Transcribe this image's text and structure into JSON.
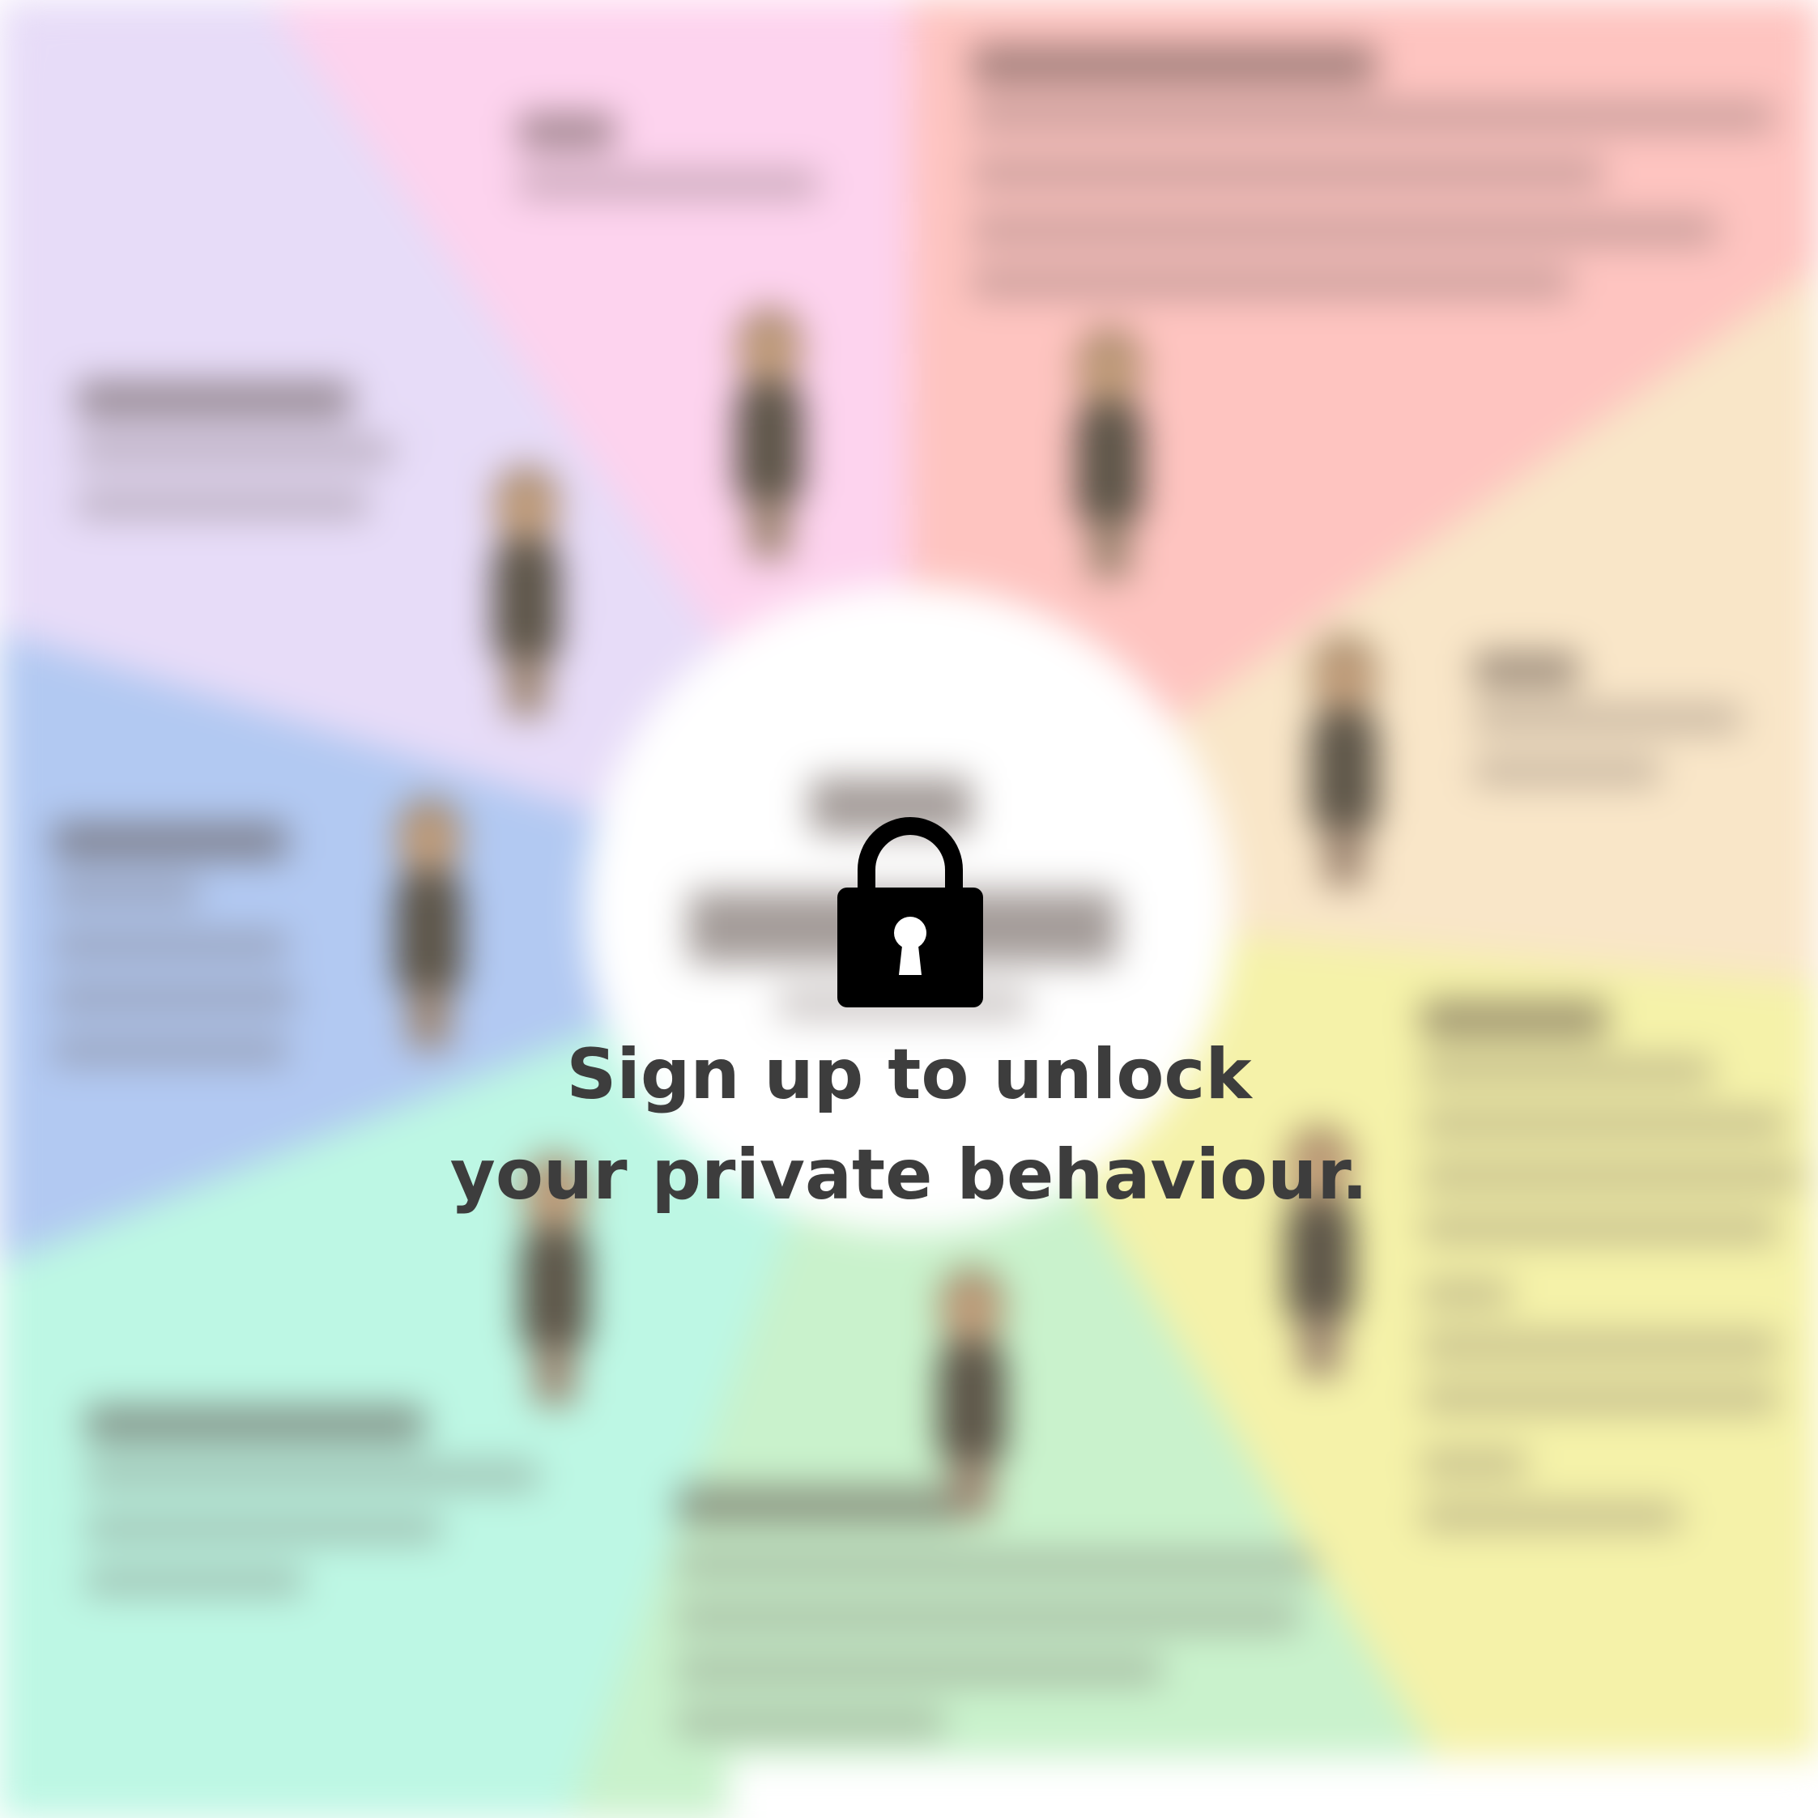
{
  "overlay": {
    "lock_icon": "padlock-icon",
    "line1": "Sign up to unlock",
    "line2": "your private behaviour."
  },
  "colors": {
    "text": "#3d3d3d",
    "lock": "#000000",
    "center_circle": "#ffffff",
    "wedge_purple": "#e7dcf8",
    "wedge_pink": "#fdd3ee",
    "wedge_red": "#fec4c0",
    "wedge_peach": "#f9e6c8",
    "wedge_yellow": "#f5f2a9",
    "wedge_green": "#c9f2cc",
    "wedge_mint": "#bdf7e4",
    "wedge_blue": "#b2c9f2"
  }
}
